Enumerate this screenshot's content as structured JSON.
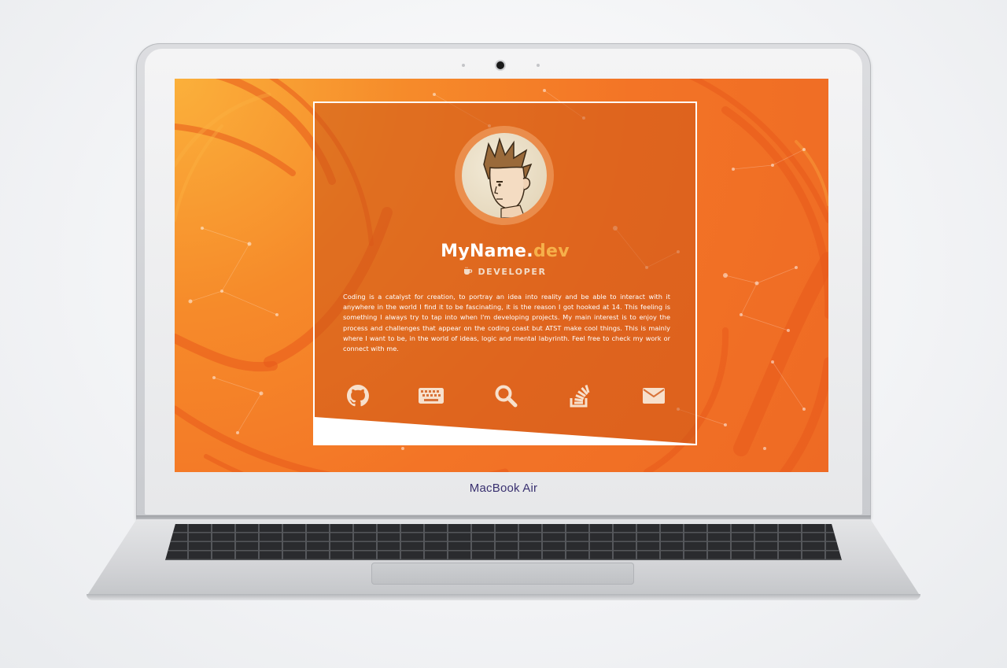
{
  "device": {
    "brand_label": "MacBook Air"
  },
  "profile": {
    "name_main": "MyName.",
    "name_accent": "dev",
    "role": "DEVELOPER",
    "bio": "Coding is a catalyst for creation, to portray an idea into reality and be able to interact with it anywhere in the world I find it to be fascinating, it is the reason I got hooked at 14. This feeling is something I always try to tap into when I'm developing projects. My main interest is to enjoy the process and challenges that appear on the coding coast but ATST make cool things. This is mainly where I want to be, in the world of ideas, logic and mental labyrinth. Feel free to check my work or connect with me."
  },
  "social_links": [
    {
      "icon": "github-icon"
    },
    {
      "icon": "keyboard-icon"
    },
    {
      "icon": "search-icon"
    },
    {
      "icon": "stackoverflow-icon"
    },
    {
      "icon": "envelope-icon"
    }
  ],
  "colors": {
    "background_orange": "#f37426",
    "accent_gold": "#f6b04a",
    "card_overlay": "#ce5818"
  }
}
